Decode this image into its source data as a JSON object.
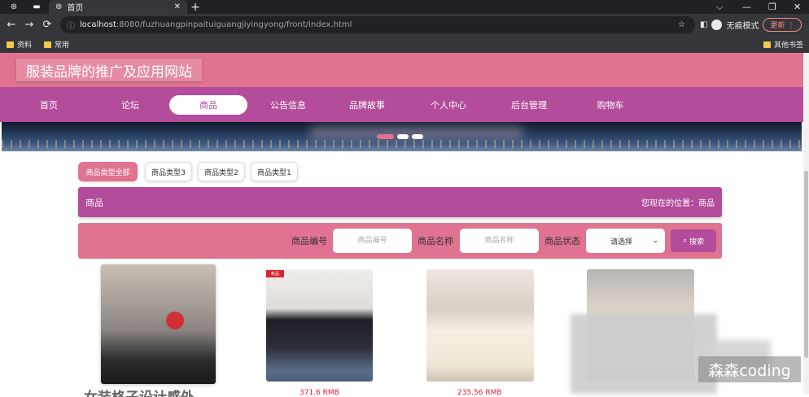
{
  "browser": {
    "tab_title": "首页",
    "url_host": "localhost",
    "url_path": ":8080/fuzhuangpinpaituiguangjiyingyong/front/index.html",
    "incognito_label": "无痕模式",
    "update_label": "更新",
    "bookmarks": [
      "资料",
      "常用"
    ],
    "other_bookmarks": "其他书签"
  },
  "site": {
    "title": "服装品牌的推广及应用网站",
    "nav": [
      "首页",
      "论坛",
      "商品",
      "公告信息",
      "品牌故事",
      "个人中心",
      "后台管理",
      "购物车"
    ],
    "active_nav": "商品"
  },
  "categories": [
    "商品类型全部",
    "商品类型3",
    "商品类型2",
    "商品类型1"
  ],
  "section": {
    "title": "商品",
    "location": "您现在的位置：商品"
  },
  "search": {
    "code_label": "商品编号",
    "code_placeholder": "商品编号",
    "name_label": "商品名称",
    "name_placeholder": "商品名称",
    "status_label": "商品状态",
    "status_value": "请选择",
    "button_label": "搜索"
  },
  "products": {
    "badge": "新品",
    "title_partial": "女装格子设计感外",
    "price1": "371.6 RMB",
    "price2": "235.56 RMB"
  },
  "watermark": "森森coding",
  "colors": {
    "header_pink": "#e0738f",
    "nav_purple": "#b34c9a",
    "price_red": "#e02030"
  }
}
